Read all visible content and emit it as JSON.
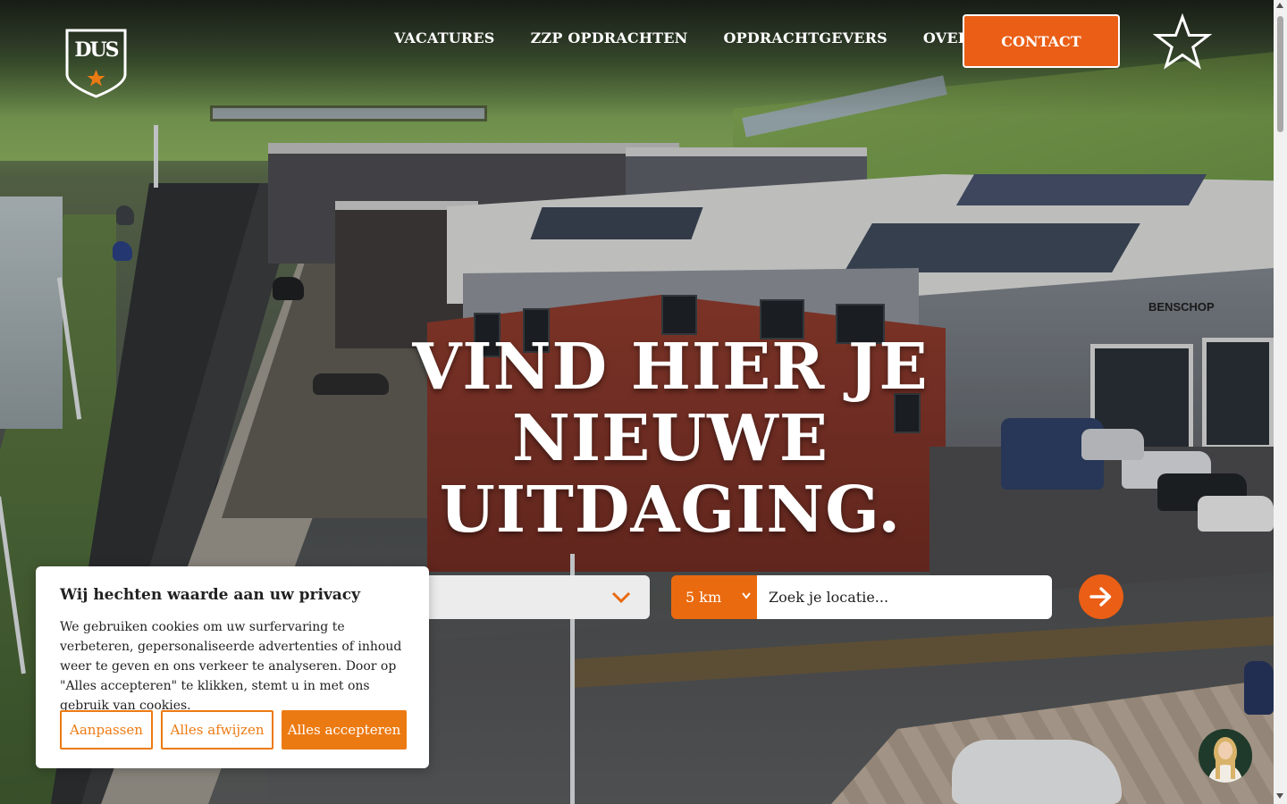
{
  "brand": {
    "logo_text": "DUS",
    "accent": "#ea5e16",
    "hero_sign_text": "BENSCHOP"
  },
  "nav": {
    "items": [
      "VACATURES",
      "ZZP OPDRACHTEN",
      "OPDRACHTGEVERS",
      "OVER DUS"
    ],
    "contact_label": "CONTACT",
    "favorites_icon": "star-outline-icon"
  },
  "hero": {
    "headline_line1": "VIND HIER JE",
    "headline_line2": "NIEUWE",
    "headline_line3": "UITDAGING."
  },
  "search": {
    "function_value": "",
    "radius_value": "5 km",
    "location_placeholder": "Zoek je locatie...",
    "submit_icon": "arrow-right-icon"
  },
  "cookie_banner": {
    "title": "Wij hechten waarde aan uw privacy",
    "body": "We gebruiken cookies om uw surfervaring te verbeteren, gepersonaliseerde advertenties of inhoud weer te geven en ons verkeer te analyseren. Door op \"Alles accepteren\" te klikken, stemt u in met ons gebruik van cookies.",
    "customize_label": "Aanpassen",
    "reject_label": "Alles afwijzen",
    "accept_label": "Alles accepteren"
  },
  "chat": {
    "icon": "chat-avatar-icon"
  }
}
